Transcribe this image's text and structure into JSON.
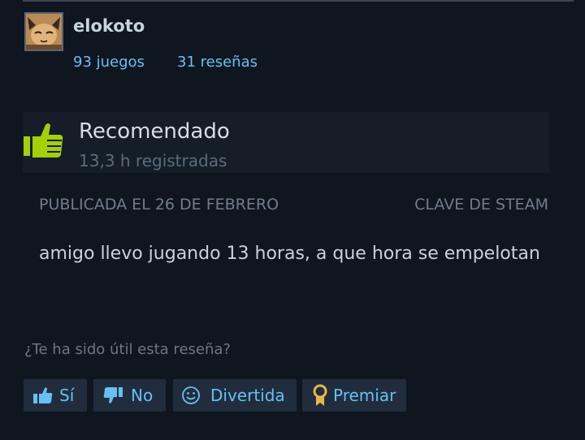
{
  "author": {
    "name": "elokoto",
    "games": "93 juegos",
    "reviews": "31 reseñas"
  },
  "review": {
    "recommendation": "Recomendado",
    "hours": "13,3 h registradas",
    "posted": "PUBLICADA EL 26 DE FEBRERO",
    "product_type": "CLAVE DE STEAM",
    "body": "amigo llevo jugando 13 horas, a que hora se empelotan"
  },
  "controls": {
    "prompt": "¿Te ha sido útil esta reseña?",
    "yes": "Sí",
    "no": "No",
    "funny": "Divertida",
    "award": "Premiar"
  },
  "colors": {
    "background": "#0f1620",
    "link": "#66c0f4",
    "thumb_up": "#a4d007",
    "award": "#e8b64a"
  },
  "icons": [
    "thumbs-up-icon",
    "thumbs-down-icon",
    "smiley-icon",
    "award-ribbon-icon"
  ]
}
